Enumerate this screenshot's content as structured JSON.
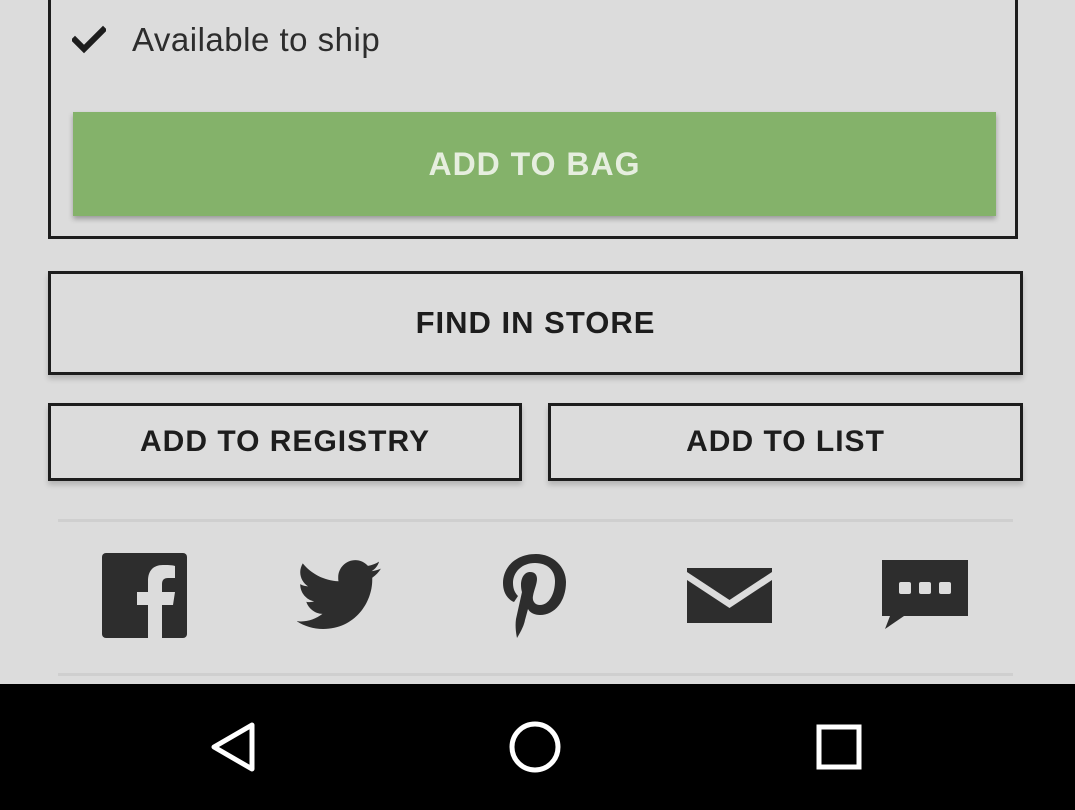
{
  "availability": {
    "text": "Available to ship",
    "checked_icon": "checkmark-icon"
  },
  "buttons": {
    "add_to_bag": "ADD TO BAG",
    "find_in_store": "FIND IN STORE",
    "add_to_registry": "ADD TO REGISTRY",
    "add_to_list": "ADD TO LIST"
  },
  "share": {
    "icons": [
      "facebook-icon",
      "twitter-icon",
      "pinterest-icon",
      "email-icon",
      "sms-icon"
    ]
  },
  "navigation_bar": {
    "icons": [
      "back-icon",
      "home-icon",
      "recents-icon"
    ]
  },
  "colors": {
    "primary_button": "#84b26a",
    "primary_button_text": "#e6eedf",
    "background": "#dcdcdc",
    "border": "#1d1d1d",
    "nav_background": "#000000"
  }
}
